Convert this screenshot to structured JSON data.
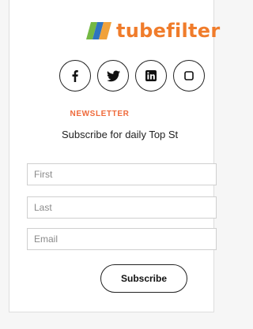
{
  "brand": {
    "logo_text": "tubefilter",
    "colors": {
      "accent": "#f07c2b",
      "eyebrow": "#ef6a3b",
      "mark_green": "#74b843",
      "mark_blue": "#2f74c0",
      "mark_orange": "#f0a23b"
    }
  },
  "social": {
    "icons": [
      "facebook-icon",
      "twitter-icon",
      "linkedin-icon",
      "more-social-icon"
    ]
  },
  "newsletter": {
    "eyebrow": "NEWSLETTER",
    "subtitle": "Subscribe for daily Top St"
  },
  "form": {
    "first_placeholder": "First",
    "last_placeholder": "Last",
    "email_placeholder": "Email",
    "submit_label": "Subscribe"
  }
}
